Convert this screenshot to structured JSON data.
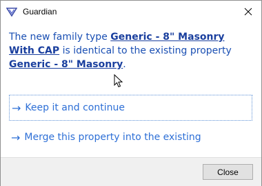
{
  "window": {
    "title": "Guardian",
    "close_icon": "close-icon"
  },
  "message": {
    "part1": "The new family type ",
    "new_type": "Generic - 8\" Masonry With CAP",
    "part2": " is identical to the existing property ",
    "existing_type": "Generic - 8\" Masonry",
    "part3": "."
  },
  "options": [
    {
      "arrow": "→",
      "label": "Keep it and continue"
    },
    {
      "arrow": "→",
      "label": "Merge this property into the existing"
    }
  ],
  "footer": {
    "close_label": "Close"
  },
  "colors": {
    "link": "#1a3f9e",
    "text": "#1a4fb3",
    "option": "#2d6fd6"
  }
}
